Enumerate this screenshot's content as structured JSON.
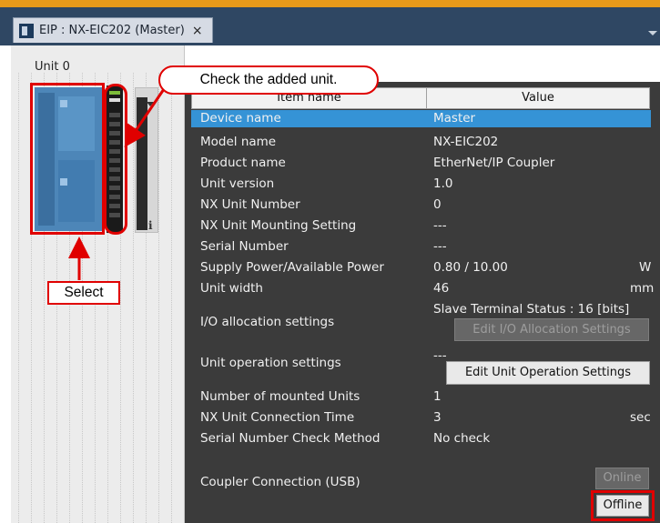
{
  "tab": {
    "title": "EIP : NX-EIC202 (Master)",
    "close": "×"
  },
  "left_panel": {
    "unit_label": "Unit 0",
    "info_glyph": "i"
  },
  "annotations": {
    "check_callout": "Check the added unit.",
    "select_label": "Select"
  },
  "table": {
    "header": {
      "item": "Item name",
      "value": "Value"
    },
    "rows": {
      "device_name": {
        "label": "Device name",
        "value": "Master"
      },
      "model_name": {
        "label": "Model name",
        "value": "NX-EIC202"
      },
      "product_name": {
        "label": "Product name",
        "value": "EtherNet/IP Coupler"
      },
      "unit_version": {
        "label": "Unit version",
        "value": "1.0"
      },
      "nx_unit_number": {
        "label": "NX Unit Number",
        "value": "0"
      },
      "mounting_setting": {
        "label": "NX Unit Mounting Setting",
        "value": "---"
      },
      "serial_number": {
        "label": "Serial Number",
        "value": "---"
      },
      "supply_power": {
        "label": "Supply Power/Available Power",
        "value": "0.80 / 10.00",
        "unit": "W"
      },
      "unit_width": {
        "label": "Unit width",
        "value": "46",
        "unit": "mm"
      },
      "io_allocation": {
        "label": "I/O allocation settings",
        "value": "Slave Terminal Status : 16 [bits]",
        "button": "Edit I/O Allocation Settings"
      },
      "unit_operation": {
        "label": "Unit operation settings",
        "value": "---",
        "button": "Edit Unit Operation Settings"
      },
      "mounted_units": {
        "label": "Number of mounted Units",
        "value": "1"
      },
      "connection_time": {
        "label": "NX Unit Connection Time",
        "value": "3",
        "unit": "sec"
      },
      "serial_check": {
        "label": "Serial Number Check Method",
        "value": "No check"
      },
      "coupler_connection": {
        "label": "Coupler Connection (USB)",
        "online": "Online",
        "offline": "Offline"
      }
    }
  },
  "colors": {
    "accent_red": "#e00000",
    "selection_blue": "#3593d6",
    "panel_dark": "#3b3b3b",
    "title_bar": "#2f4763"
  }
}
